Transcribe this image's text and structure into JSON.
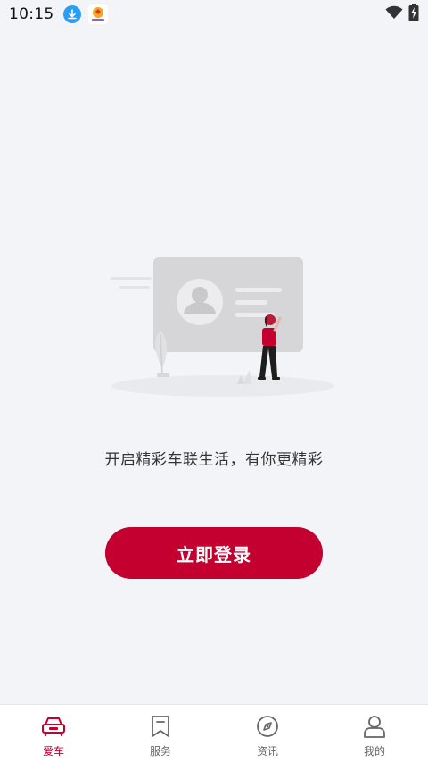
{
  "status_bar": {
    "time": "10:15",
    "icons": [
      "download-icon",
      "app-notification-icon",
      "wifi-icon",
      "battery-charging-icon"
    ]
  },
  "main": {
    "prompt": "开启精彩车联生活，有你更精彩",
    "login_button": "立即登录"
  },
  "bottom_nav": {
    "items": [
      {
        "label": "爱车",
        "icon": "car-icon",
        "active": true
      },
      {
        "label": "服务",
        "icon": "bookmark-icon",
        "active": false
      },
      {
        "label": "资讯",
        "icon": "compass-icon",
        "active": false
      },
      {
        "label": "我的",
        "icon": "user-icon",
        "active": false
      }
    ]
  },
  "colors": {
    "accent": "#c3002f",
    "background": "#f3f4f7",
    "nav_inactive": "#666666"
  }
}
